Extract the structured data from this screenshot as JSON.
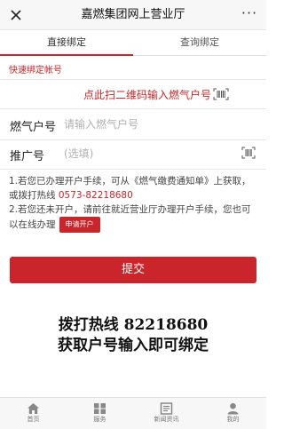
{
  "titlebar": {
    "title": "嘉燃集团网上营业厅",
    "more": "···"
  },
  "tabs": [
    {
      "label": "直接绑定",
      "active": true
    },
    {
      "label": "查询绑定",
      "active": false
    }
  ],
  "quick_bind": {
    "section_label": "快速绑定帐号",
    "scan_text": "点此扫二维码输入燃气户号"
  },
  "fields": {
    "gas_account": {
      "label": "燃气户号",
      "placeholder": "请输入燃气户号",
      "value": ""
    },
    "referral": {
      "label": "推广号",
      "placeholder": "(选填)",
      "value": ""
    }
  },
  "notes": {
    "line1_pre": "1.若您已办理开户手续，可从《燃气缴费通知单》上获取，或拨打热线 ",
    "phone": "0573-82218680",
    "line2": "2.若您还未开户，请前往就近营业厅办理开户手续，您也可以在线办理",
    "open_account_button": "申请开户"
  },
  "submit_button": "提交",
  "banner": {
    "line1": "拨打热线 82218680",
    "line2": "获取户号输入即可绑定"
  },
  "bottom_nav": [
    {
      "label": "首页",
      "icon": "home-icon"
    },
    {
      "label": "服务",
      "icon": "service-icon"
    },
    {
      "label": "新闻资讯",
      "icon": "news-icon"
    },
    {
      "label": "我的",
      "icon": "user-icon"
    }
  ],
  "colors": {
    "accent": "#c9252a",
    "background": "#ffffff",
    "nav_background": "#f7f7f7"
  }
}
